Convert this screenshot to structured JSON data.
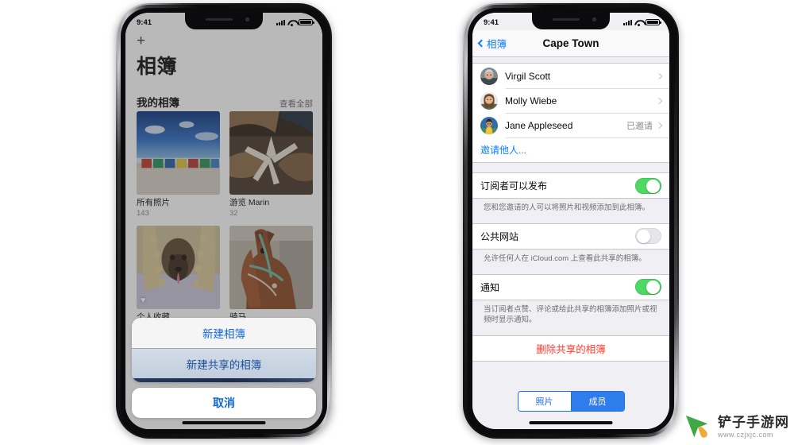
{
  "left_phone": {
    "status_bar": {
      "time": "9:41",
      "signal_icon": "cellular-bars-icon",
      "wifi_icon": "wifi-icon",
      "battery_icon": "battery-icon"
    },
    "nav": {
      "add_icon": "plus-icon",
      "title": "相簿"
    },
    "section": {
      "title": "我的相簿",
      "see_all": "查看全部"
    },
    "albums": [
      {
        "name": "所有照片",
        "count": "143",
        "image": "beach-huts-photo",
        "favorite": false
      },
      {
        "name": "游览 Marin",
        "count": "32",
        "image": "starfish-in-hands-photo",
        "favorite": false
      },
      {
        "name": "个人收藏",
        "count": "",
        "image": "dog-under-blanket-photo",
        "favorite": true
      },
      {
        "name": "骑马",
        "count": "",
        "image": "brown-horse-photo",
        "favorite": false
      }
    ],
    "action_sheet": {
      "new_album": "新建相簿",
      "new_shared_album": "新建共享的相簿",
      "cancel": "取消"
    }
  },
  "right_phone": {
    "status_bar": {
      "time": "9:41",
      "signal_icon": "cellular-bars-icon",
      "wifi_icon": "wifi-icon",
      "battery_icon": "battery-icon"
    },
    "nav": {
      "back_label": "相簿",
      "back_icon": "chevron-left-icon",
      "title": "Cape Town"
    },
    "people": [
      {
        "name": "Virgil Scott",
        "status": "",
        "avatar": "man-grey-hair-avatar"
      },
      {
        "name": "Molly Wiebe",
        "status": "",
        "avatar": "woman-smiling-avatar"
      },
      {
        "name": "Jane Appleseed",
        "status": "已邀请",
        "avatar": "woman-yellow-top-avatar"
      }
    ],
    "invite_label": "邀请他人...",
    "settings": [
      {
        "label": "订阅者可以发布",
        "on": true,
        "desc": "您和您邀请的人可以将照片和视频添加到此相簿。"
      },
      {
        "label": "公共网站",
        "on": false,
        "desc": "允许任何人在 iCloud.com 上查看此共享的相簿。"
      },
      {
        "label": "通知",
        "on": true,
        "desc": "当订阅者点赞、评论或给此共享的相簿添加照片或视频时显示通知。"
      }
    ],
    "delete_label": "删除共享的相簿",
    "segmented": {
      "options": [
        "照片",
        "成员"
      ],
      "selected": "成员"
    }
  },
  "watermark": {
    "title": "铲子手游网",
    "url": "www.czjxjc.com",
    "logo_icon": "green-cursor-logo-icon"
  },
  "colors": {
    "ios_blue": "#0a7cff",
    "action_blue": "#1368d4",
    "switch_green": "#4cd964",
    "danger_red": "#ff3b30",
    "segment_blue": "#2f7ced"
  }
}
